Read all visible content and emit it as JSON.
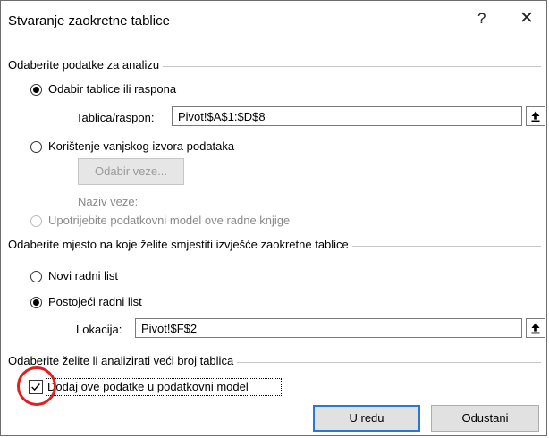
{
  "dialog": {
    "title": "Stvaranje zaokretne tablice",
    "help_glyph": "?",
    "close_glyph": "✕"
  },
  "section1": {
    "title": "Odaberite podatke za analizu",
    "option_table_label": "Odabir tablice ili raspona",
    "table_range_label": "Tablica/raspon:",
    "table_range_value": "Pivot!$A$1:$D$8",
    "option_external_label": "Korištenje vanjskog izvora podataka",
    "choose_connection_label": "Odabir veze...",
    "connection_name_label": "Naziv veze:",
    "option_data_model_label": "Upotrijebite podatkovni model ove radne knjige"
  },
  "section2": {
    "title": "Odaberite mjesto na koje želite smjestiti izvješće zaokretne tablice",
    "option_new_sheet_label": "Novi radni list",
    "option_existing_sheet_label": "Postojeći radni list",
    "location_label": "Lokacija:",
    "location_value": "Pivot!$F$2"
  },
  "section3": {
    "title": "Odaberite želite li analizirati veći broj tablica",
    "add_to_model_label": "Dodaj ove podatke u podatkovni model",
    "add_to_model_checked": true
  },
  "buttons": {
    "ok_label": "U redu",
    "cancel_label": "Odustani"
  },
  "colors": {
    "annotation_circle": "#e02020",
    "default_button_border": "#2b78d4"
  }
}
